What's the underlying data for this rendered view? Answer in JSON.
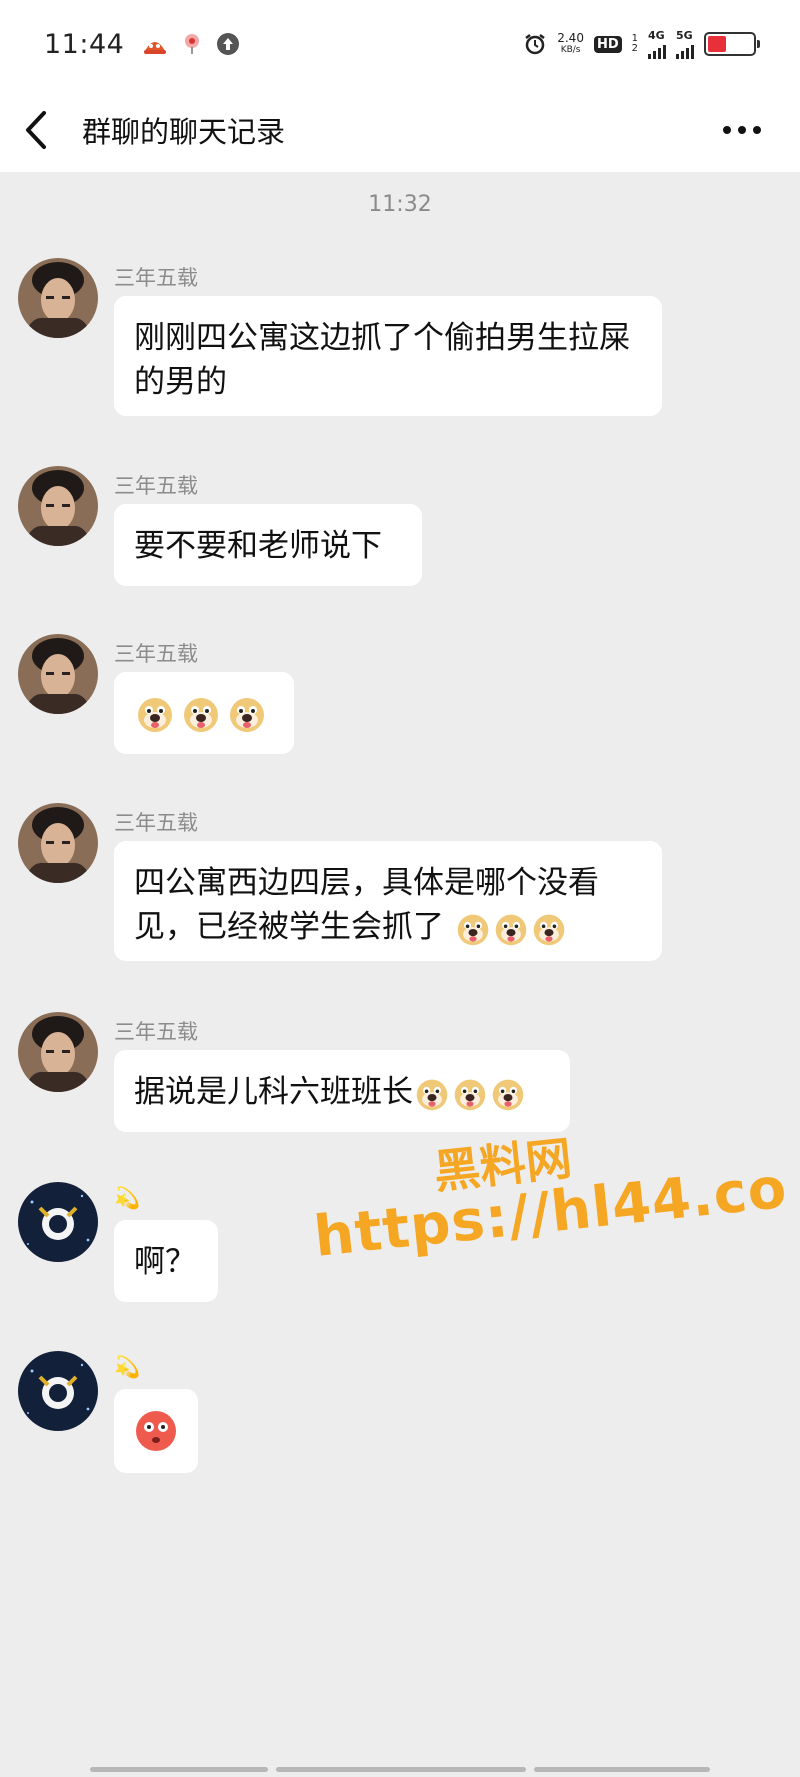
{
  "status_bar": {
    "time": "11:44",
    "net_speed_value": "2.40",
    "net_speed_unit": "KB/s",
    "hd_label": "HD",
    "hd_sub": "1\n2",
    "net1": "4G",
    "net2": "5G",
    "battery_level": 0.4,
    "icons": [
      "notification-app-icon",
      "location-pin-icon",
      "upload-icon",
      "alarm-icon",
      "signal-icon",
      "battery-icon"
    ]
  },
  "header": {
    "title": "群聊的聊天记录"
  },
  "chat": {
    "timestamp": "11:32",
    "messages": [
      {
        "sender": "三年五载",
        "text": "刚刚四公寓这边抓了个偷拍男生拉屎的男的"
      },
      {
        "sender": "三年五载",
        "text": "要不要和老师说下"
      },
      {
        "sender": "三年五载",
        "text": ""
      },
      {
        "sender": "三年五载",
        "text": "四公寓西边四层，具体是哪个没看见，已经被学生会抓了"
      },
      {
        "sender": "三年五载",
        "text": "据说是儿科六班班长"
      },
      {
        "sender": "💫",
        "text": "啊？"
      },
      {
        "sender": "💫",
        "text": ""
      }
    ]
  },
  "watermark": {
    "line1": "黑料网",
    "line2": "https://hl44.co"
  },
  "colors": {
    "background": "#ededed",
    "bubble": "#ffffff",
    "watermark": "#f5a623",
    "battery": "#e8303a"
  }
}
